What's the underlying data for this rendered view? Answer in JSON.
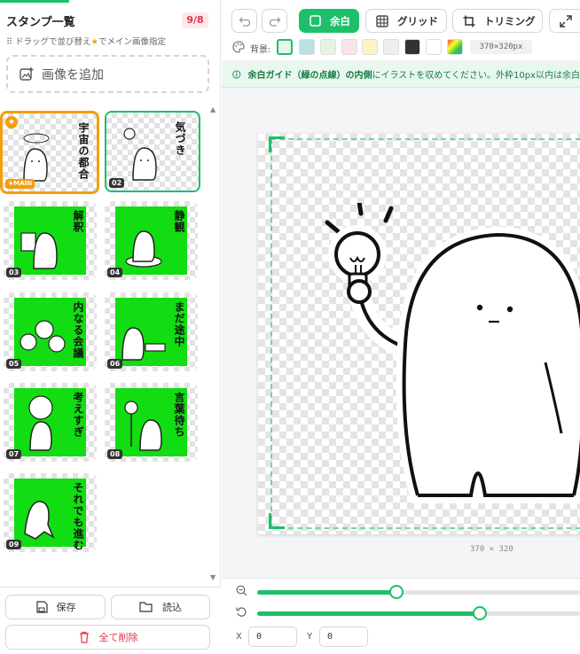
{
  "sidebar": {
    "title": "スタンプ一覧",
    "count_badge": "9/8",
    "hint_prefix": "⠿ ドラッグで並び替え",
    "hint_suffix": "でメイン画像指定",
    "add_image_label": "画像を追加",
    "stamps": [
      {
        "number": "01",
        "text": "宇宙の都合",
        "main_tag": "★MAIN",
        "background": "transparent",
        "state": "main"
      },
      {
        "number": "02",
        "text": "気づき",
        "background": "transparent",
        "state": "selected"
      },
      {
        "number": "03",
        "text": "解釈",
        "background": "green"
      },
      {
        "number": "04",
        "text": "静観",
        "background": "green"
      },
      {
        "number": "05",
        "text": "内なる会議",
        "background": "green"
      },
      {
        "number": "06",
        "text": "まだ途中",
        "background": "green"
      },
      {
        "number": "07",
        "text": "考えすぎ",
        "background": "green"
      },
      {
        "number": "08",
        "text": "言葉待ち",
        "background": "green"
      },
      {
        "number": "09",
        "text": "それでも進む",
        "background": "green"
      }
    ],
    "save_label": "保存",
    "load_label": "読込",
    "delete_all_label": "全て削除"
  },
  "toolbar": {
    "margin_label": "余白",
    "grid_label": "グリッド",
    "trim_label": "トリミング"
  },
  "background_row": {
    "label": "背景:",
    "swatches": [
      "#e6f7ee",
      "#b9e3e3",
      "#e4f3e4",
      "#fbe3ea",
      "#fdf4c6",
      "#eeeeee",
      "#333333",
      "#ffffff",
      "gradient"
    ],
    "size_readout": "370×320px"
  },
  "guide_banner": {
    "bold_part": "余白ガイド（緑の点線）の内側",
    "rest": "にイラストを収めてください。外枠10px以内は余白"
  },
  "canvas": {
    "size_label": "370 × 320"
  },
  "sliders": {
    "zoom": 0.43,
    "rotate": 0.69
  },
  "position": {
    "x_label": "X",
    "x_value": "0",
    "y_label": "Y",
    "y_value": "0"
  },
  "colors": {
    "accent": "#1dbf6b",
    "main_highlight": "#f59e0b",
    "sticker_green": "#12dc12",
    "badge_red": "#e0344a"
  }
}
